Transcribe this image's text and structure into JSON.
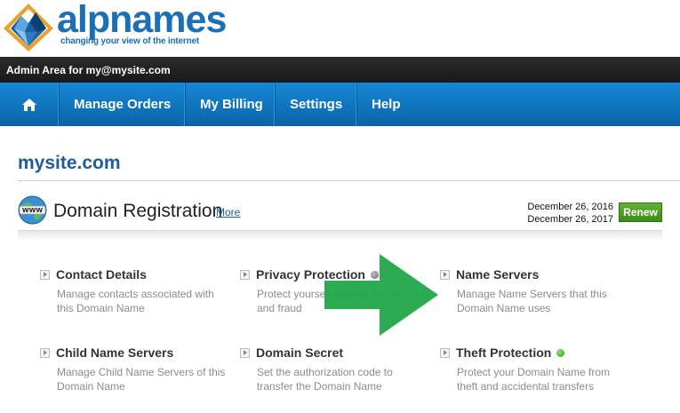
{
  "logo": {
    "wordmark": "alpnames",
    "tagline": "changing your view of the internet"
  },
  "admin_bar": {
    "text": "Admin Area for my@mysite.com"
  },
  "nav": {
    "home_icon": "home-icon",
    "items": [
      {
        "label": "Manage Orders"
      },
      {
        "label": "My Billing"
      },
      {
        "label": "Settings"
      },
      {
        "label": "Help"
      }
    ]
  },
  "domain": {
    "name": "mysite.com"
  },
  "registration": {
    "icon": "www-globe-icon",
    "title": "Domain Registration",
    "more_label": "More",
    "start_date": "December 26, 2016",
    "end_date": "December 26, 2017",
    "renew_label": "Renew"
  },
  "options": [
    {
      "title": "Contact Details",
      "desc": "Manage contacts associated with this Domain Name"
    },
    {
      "title": "Privacy Protection",
      "desc": "Protect yourself against identity theft and fraud",
      "status": "gray"
    },
    {
      "title": "Name Servers",
      "desc": "Manage Name Servers that this Domain Name uses"
    },
    {
      "title": "Child Name Servers",
      "desc": "Manage Child Name Servers of this Domain Name"
    },
    {
      "title": "Domain Secret",
      "desc": "Set the authorization code to transfer the Domain Name"
    },
    {
      "title": "Theft Protection",
      "desc": "Protect your Domain Name from theft and accidental transfers",
      "status": "green"
    }
  ],
  "colors": {
    "brand_blue": "#1a6fb5",
    "nav_blue": "#0f75c2",
    "renew_green": "#4a9e22",
    "arrow_green": "#22a64a"
  }
}
